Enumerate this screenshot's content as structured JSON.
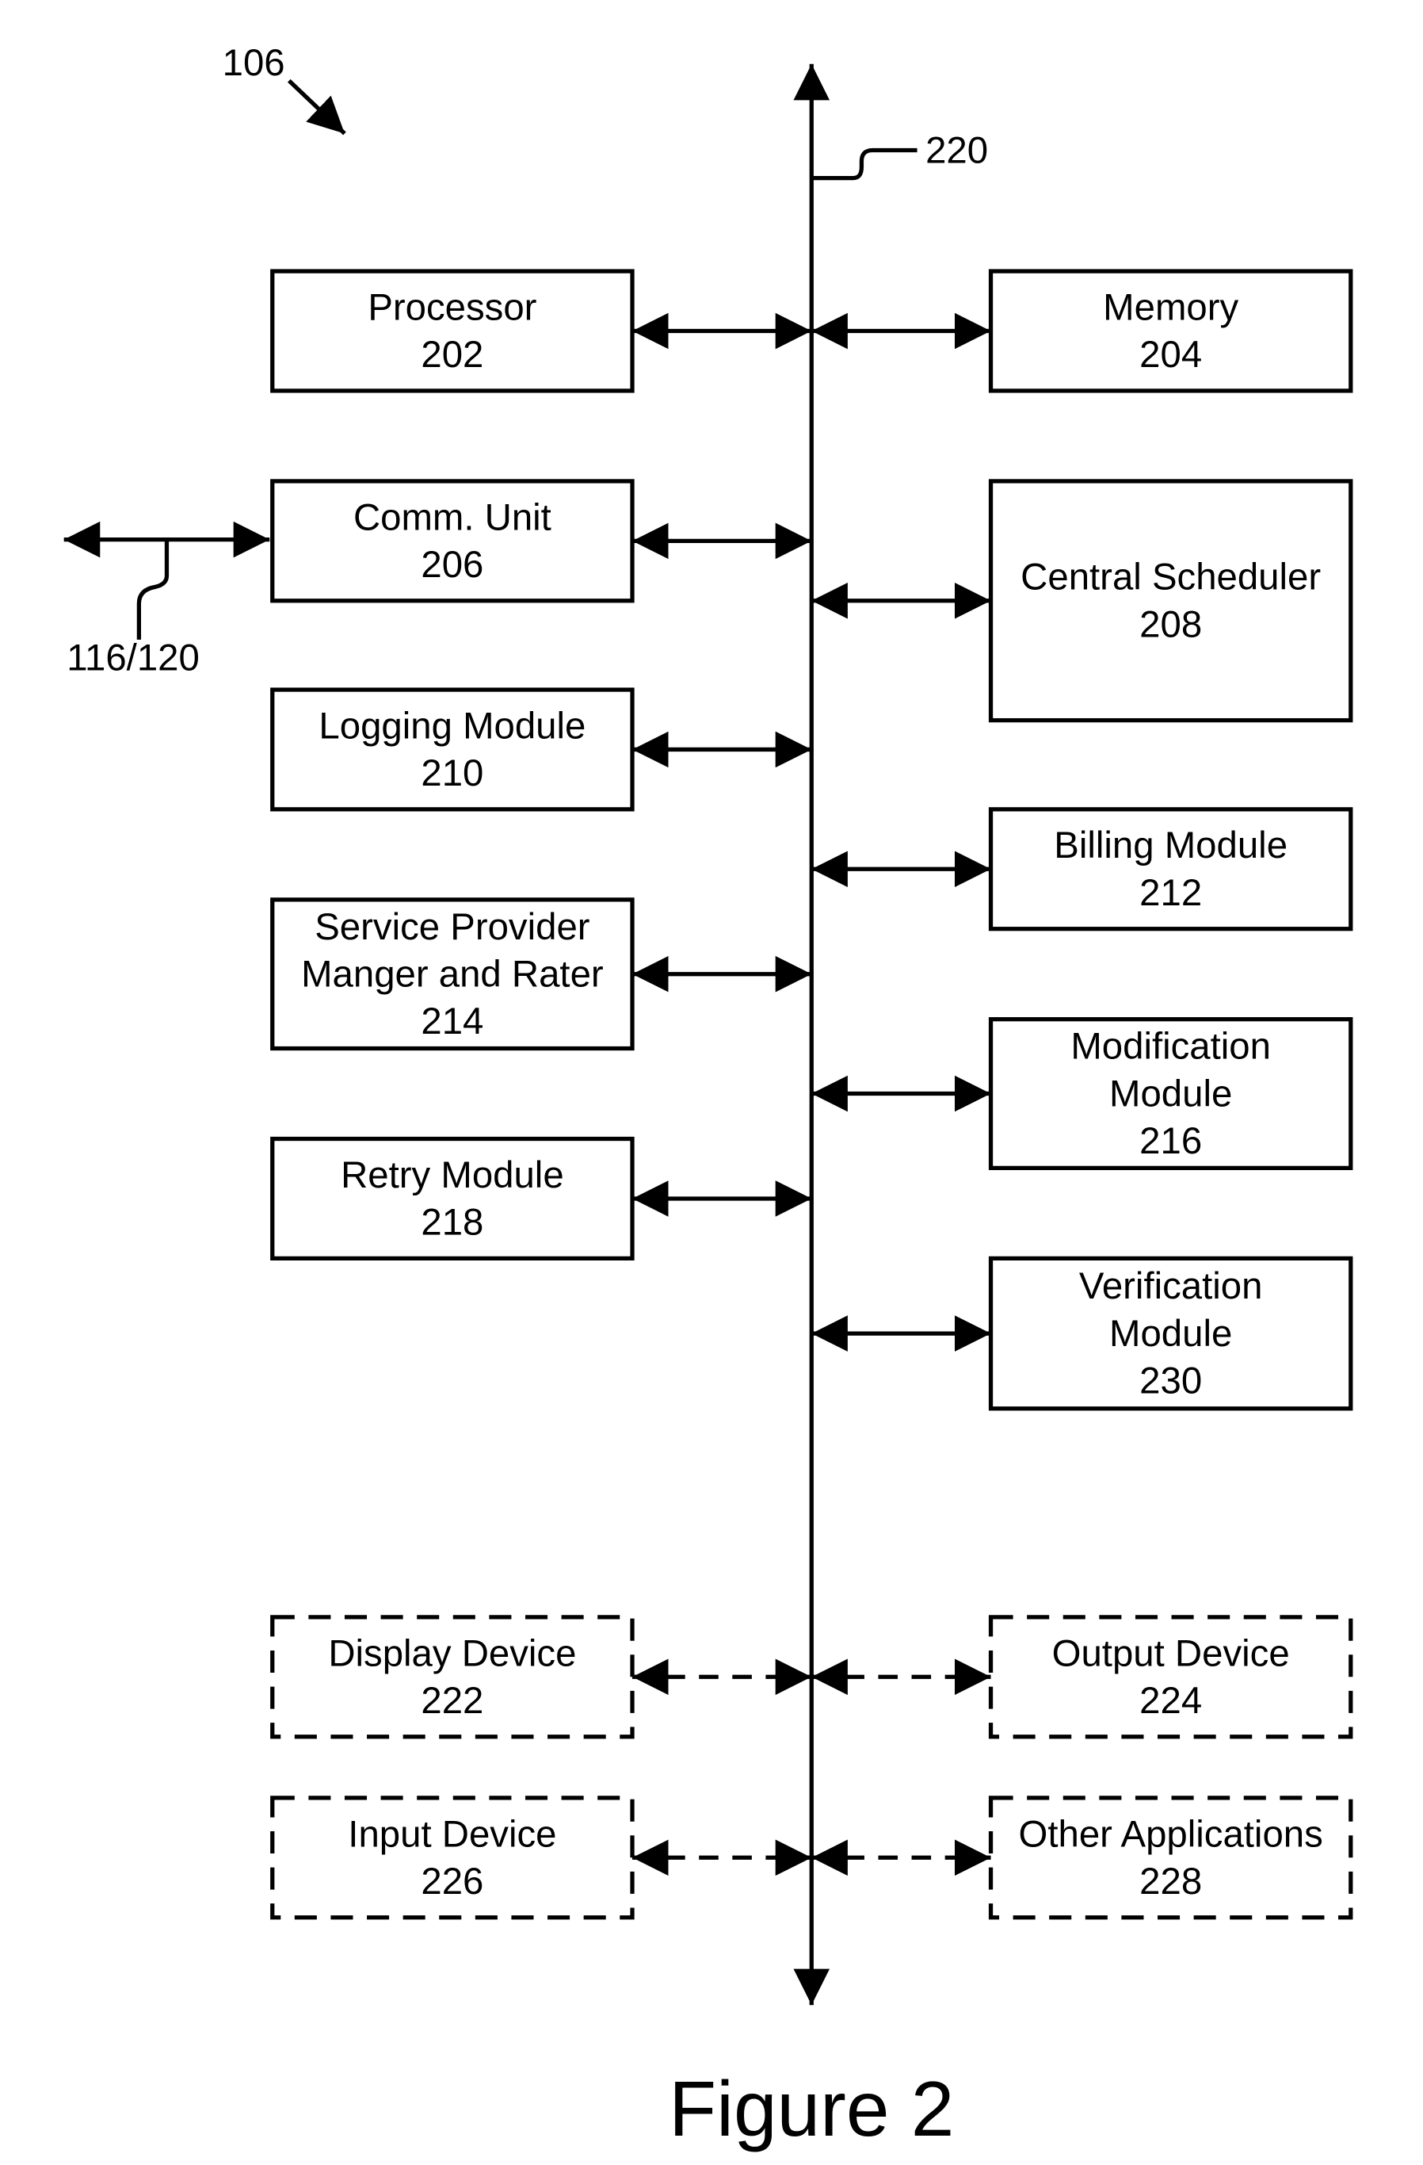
{
  "diagram": {
    "reference_label": "106",
    "bus_label": "220",
    "external_link_label": "116/120",
    "caption": "Figure 2",
    "left_components": [
      {
        "id": "processor",
        "lines": [
          "Processor",
          "202"
        ],
        "style": "solid"
      },
      {
        "id": "comm-unit",
        "lines": [
          "Comm. Unit",
          "206"
        ],
        "style": "solid"
      },
      {
        "id": "logging-module",
        "lines": [
          "Logging Module",
          "210"
        ],
        "style": "solid"
      },
      {
        "id": "service-provider-manager-rater",
        "lines": [
          "Service Provider",
          "Manger and Rater",
          "214"
        ],
        "style": "solid"
      },
      {
        "id": "retry-module",
        "lines": [
          "Retry Module",
          "218"
        ],
        "style": "solid"
      },
      {
        "id": "display-device",
        "lines": [
          "Display Device",
          "222"
        ],
        "style": "dashed"
      },
      {
        "id": "input-device",
        "lines": [
          "Input Device",
          "226"
        ],
        "style": "dashed"
      }
    ],
    "right_components": [
      {
        "id": "memory",
        "lines": [
          "Memory",
          "204"
        ],
        "style": "solid"
      },
      {
        "id": "central-scheduler",
        "lines": [
          "Central Scheduler",
          "208"
        ],
        "style": "solid"
      },
      {
        "id": "billing-module",
        "lines": [
          "Billing Module",
          "212"
        ],
        "style": "solid"
      },
      {
        "id": "modification-module",
        "lines": [
          "Modification",
          "Module",
          "216"
        ],
        "style": "solid"
      },
      {
        "id": "verification-module",
        "lines": [
          "Verification",
          "Module",
          "230"
        ],
        "style": "solid"
      },
      {
        "id": "output-device",
        "lines": [
          "Output Device",
          "224"
        ],
        "style": "dashed"
      },
      {
        "id": "other-applications",
        "lines": [
          "Other Applications",
          "228"
        ],
        "style": "dashed"
      }
    ]
  }
}
